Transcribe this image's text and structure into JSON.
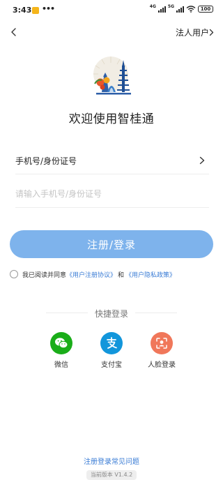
{
  "status_bar": {
    "time": "3:43",
    "dots": "•••",
    "net1": "4G",
    "net2": "5G",
    "battery": "100"
  },
  "nav": {
    "corp_user_link": "法人用户"
  },
  "welcome_title": "欢迎使用智桂通",
  "form": {
    "account_type_label": "手机号/身份证号",
    "account_placeholder": "请输入手机号/身份证号",
    "account_value": "",
    "submit_label": "注册/登录"
  },
  "agreement": {
    "prefix": "我已阅读并同意",
    "user_agreement": "《用户注册协议》",
    "conjunction": "和",
    "privacy_policy": "《用户隐私政策》",
    "checked": false
  },
  "quick_login": {
    "title": "快捷登录",
    "items": [
      {
        "label": "微信",
        "icon": "wechat-icon",
        "color": "#1aad19"
      },
      {
        "label": "支付宝",
        "icon": "alipay-icon",
        "color": "#1296db"
      },
      {
        "label": "人脸登录",
        "icon": "face-login-icon",
        "color": "#f0775a"
      }
    ]
  },
  "footer": {
    "faq_link": "注册登录常见问题",
    "version": "当前版本 V1.4.2"
  },
  "colors": {
    "primary_button": "#7eb3ec",
    "link": "#3a7cd5"
  }
}
